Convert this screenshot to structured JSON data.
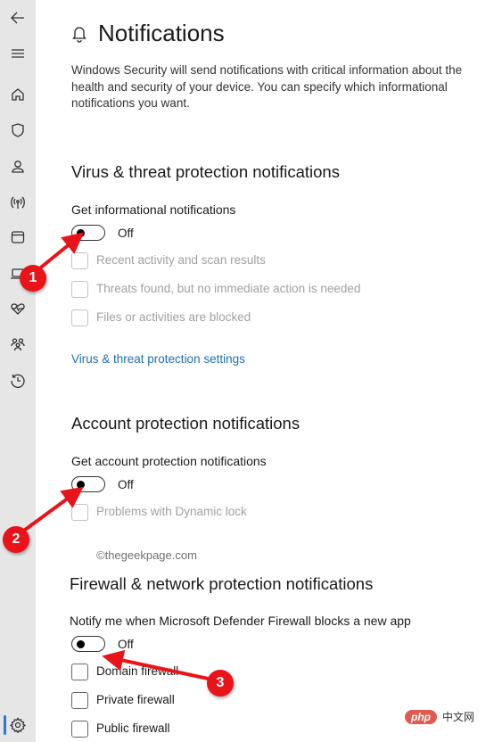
{
  "sidebar": {
    "items": [
      {
        "icon": "back-arrow-icon"
      },
      {
        "icon": "hamburger-menu-icon"
      },
      {
        "icon": "home-icon"
      },
      {
        "icon": "shield-icon"
      },
      {
        "icon": "account-icon"
      },
      {
        "icon": "network-antenna-icon"
      },
      {
        "icon": "app-browser-icon"
      },
      {
        "icon": "device-laptop-icon"
      },
      {
        "icon": "health-heart-icon"
      },
      {
        "icon": "family-icon"
      },
      {
        "icon": "history-icon"
      },
      {
        "icon": "settings-gear-icon"
      }
    ],
    "active_item": "settings"
  },
  "page": {
    "title": "Notifications",
    "description": "Windows Security will send notifications with critical information about the health and security of your device. You can specify which informational notifications you want."
  },
  "sections": {
    "virus": {
      "heading": "Virus & threat protection notifications",
      "toggle_label": "Get informational notifications",
      "toggle_state": "Off",
      "checkboxes": [
        {
          "label": "Recent activity and scan results",
          "checked": false,
          "disabled": true
        },
        {
          "label": "Threats found, but no immediate action is needed",
          "checked": false,
          "disabled": true
        },
        {
          "label": "Files or activities are blocked",
          "checked": false,
          "disabled": true
        }
      ],
      "link": "Virus & threat protection settings"
    },
    "account": {
      "heading": "Account protection notifications",
      "toggle_label": "Get account protection notifications",
      "toggle_state": "Off",
      "checkboxes": [
        {
          "label": "Problems with Dynamic lock",
          "checked": false,
          "disabled": true
        }
      ]
    },
    "firewall": {
      "heading": "Firewall & network protection notifications",
      "toggle_label": "Notify me when Microsoft Defender Firewall blocks a new app",
      "toggle_state": "Off",
      "checkboxes": [
        {
          "label": "Domain firewall",
          "checked": false,
          "disabled": false
        },
        {
          "label": "Private firewall",
          "checked": false,
          "disabled": false
        },
        {
          "label": "Public firewall",
          "checked": false,
          "disabled": false
        }
      ]
    }
  },
  "watermark": "©thegeekpage.com",
  "annotations": [
    {
      "number": "1",
      "target": "virus-toggle"
    },
    {
      "number": "2",
      "target": "account-toggle"
    },
    {
      "number": "3",
      "target": "firewall-toggle"
    }
  ],
  "annotation_color": "#e8141a",
  "accent_color": "#1f6fb5",
  "brand_badge": {
    "pill": "php",
    "text": "中文网"
  }
}
